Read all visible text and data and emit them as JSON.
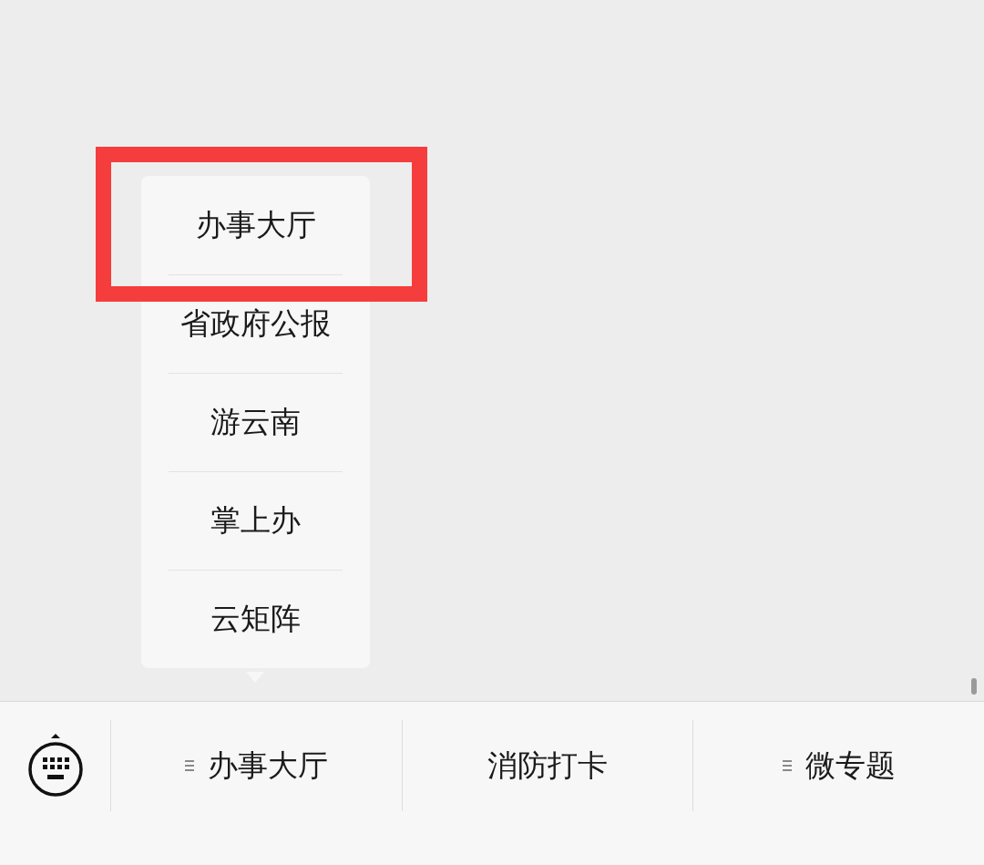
{
  "popup_menu": {
    "items": [
      {
        "label": "办事大厅",
        "highlighted": true
      },
      {
        "label": "省政府公报",
        "highlighted": false
      },
      {
        "label": "游云南",
        "highlighted": false
      },
      {
        "label": "掌上办",
        "highlighted": false
      },
      {
        "label": "云矩阵",
        "highlighted": false
      }
    ]
  },
  "bottom_menu": {
    "items": [
      {
        "label": "办事大厅",
        "kind": "submenu"
      },
      {
        "label": "消防打卡",
        "kind": "link"
      },
      {
        "label": "微专题",
        "kind": "submenu"
      }
    ]
  }
}
